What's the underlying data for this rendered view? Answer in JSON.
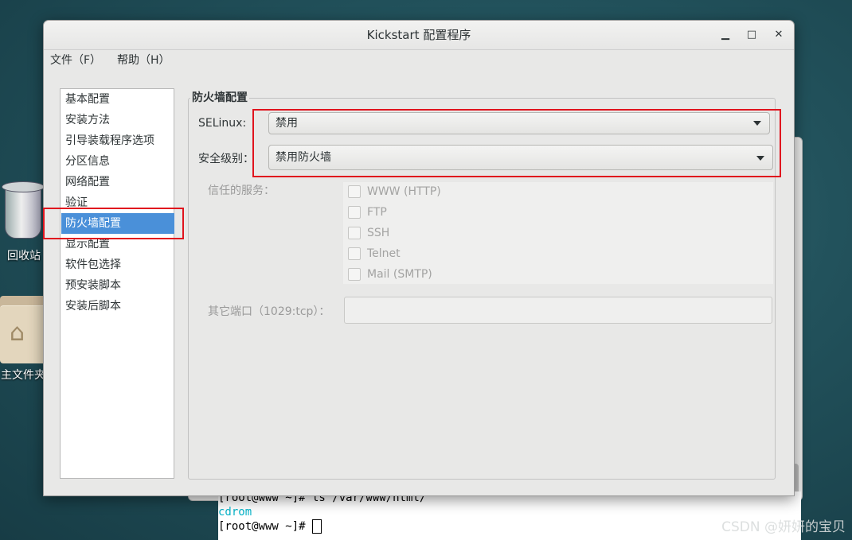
{
  "desktop": {
    "trash_label": "回收站",
    "home_label": "主文件夹"
  },
  "terminal": {
    "line1": "[root@www ~]# ls /var/www/html/",
    "line2": "cdrom",
    "line3": "[root@www ~]# "
  },
  "window": {
    "title": "Kickstart 配置程序",
    "minimize": "▁",
    "maximize": "□",
    "close": "✕"
  },
  "menu": {
    "file": "文件（F）",
    "help": "帮助（H）"
  },
  "sidebar": {
    "items": [
      {
        "label": "基本配置",
        "selected": false
      },
      {
        "label": "安装方法",
        "selected": false
      },
      {
        "label": "引导装载程序选项",
        "selected": false
      },
      {
        "label": "分区信息",
        "selected": false
      },
      {
        "label": "网络配置",
        "selected": false
      },
      {
        "label": "验证",
        "selected": false
      },
      {
        "label": "防火墙配置",
        "selected": true
      },
      {
        "label": "显示配置",
        "selected": false
      },
      {
        "label": "软件包选择",
        "selected": false
      },
      {
        "label": "预安装脚本",
        "selected": false
      },
      {
        "label": "安装后脚本",
        "selected": false
      }
    ]
  },
  "firewall": {
    "section_title": "防火墙配置",
    "selinux_label": "SELinux:",
    "selinux_value": "禁用",
    "security_label": "安全级别：",
    "security_value": "禁用防火墙",
    "trusted_label": "信任的服务：",
    "services": [
      {
        "label": "WWW (HTTP)",
        "checked": false
      },
      {
        "label": "FTP",
        "checked": false
      },
      {
        "label": "SSH",
        "checked": false
      },
      {
        "label": "Telnet",
        "checked": false
      },
      {
        "label": "Mail (SMTP)",
        "checked": false
      }
    ],
    "other_ports_label": "其它端口（1029:tcp）：",
    "other_ports_value": ""
  },
  "watermark": "CSDN @妍妍的宝贝",
  "colors": {
    "highlight": "#e0141e",
    "selection": "#4a90d9"
  }
}
